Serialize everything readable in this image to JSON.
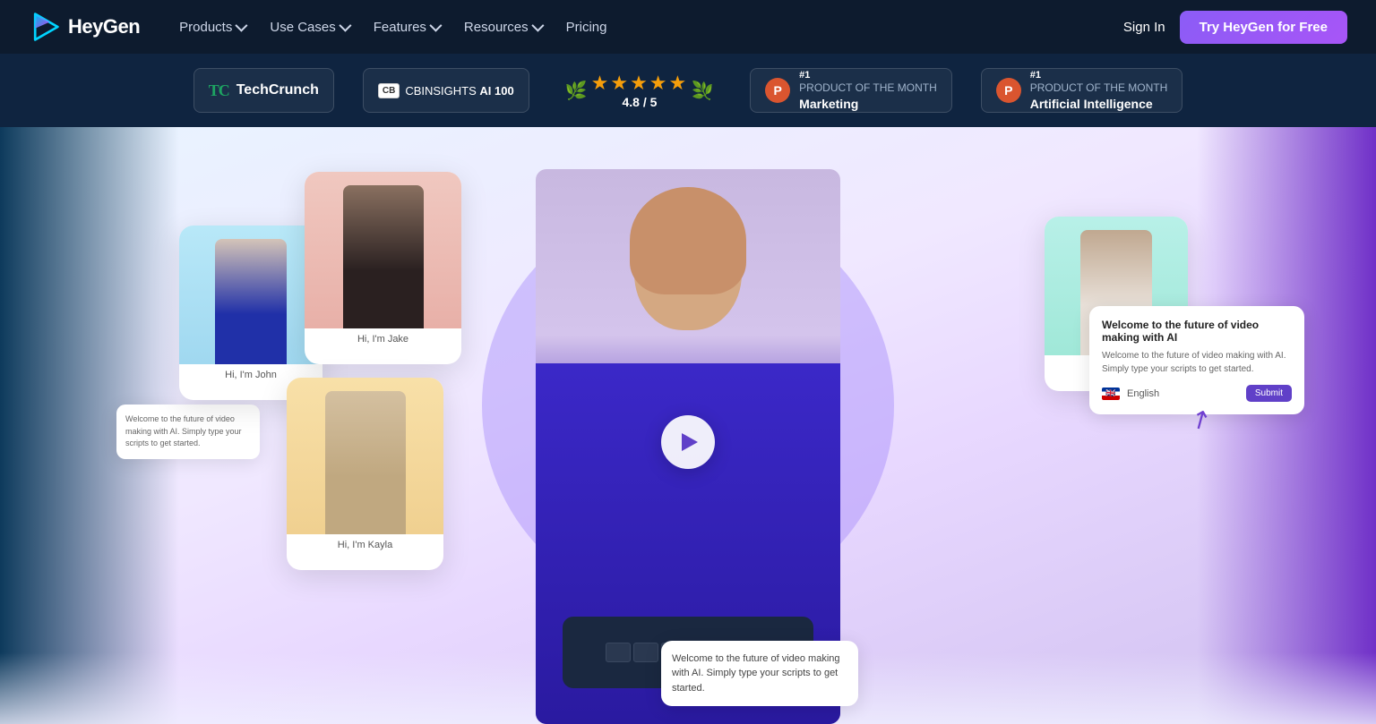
{
  "navbar": {
    "logo_text": "HeyGen",
    "products_label": "Products",
    "use_cases_label": "Use Cases",
    "features_label": "Features",
    "resources_label": "Resources",
    "pricing_label": "Pricing",
    "sign_in_label": "Sign In",
    "cta_label": "Try HeyGen for Free"
  },
  "social_proof": {
    "techcrunch_label": "TechCrunch",
    "cb_label": "CBINSIGHTS",
    "cb_suffix": "AI 100",
    "g2_rating": "4.8 / 5",
    "stars": "★★★★★",
    "product_marketing_num": "#1",
    "product_marketing_sub": "PRODUCT OF THE MONTH",
    "product_marketing_type": "Marketing",
    "product_ai_num": "#1",
    "product_ai_sub": "PRODUCT OF THE MONTH",
    "product_ai_type": "Artificial Intelligence"
  },
  "hero": {
    "card_john_label": "Hi, I'm John",
    "card_jake_label": "Hi, I'm Jake",
    "card_kayla_label": "Hi, I'm Kayla",
    "play_button_label": "Play",
    "text_card_right_title": "Welcome to the future of video making with AI",
    "text_card_right_body": "Welcome to the future of video making with AI. Simply type your scripts to get started.",
    "text_card_right_lang": "English",
    "text_card_right_submit": "Submit",
    "text_card_bottom_body": "Welcome to the future of video making with AI. Simply type your scripts to get started.",
    "text_card_left_body": "Welcome to the future of video making with AI. Simply type your scripts to get started."
  }
}
